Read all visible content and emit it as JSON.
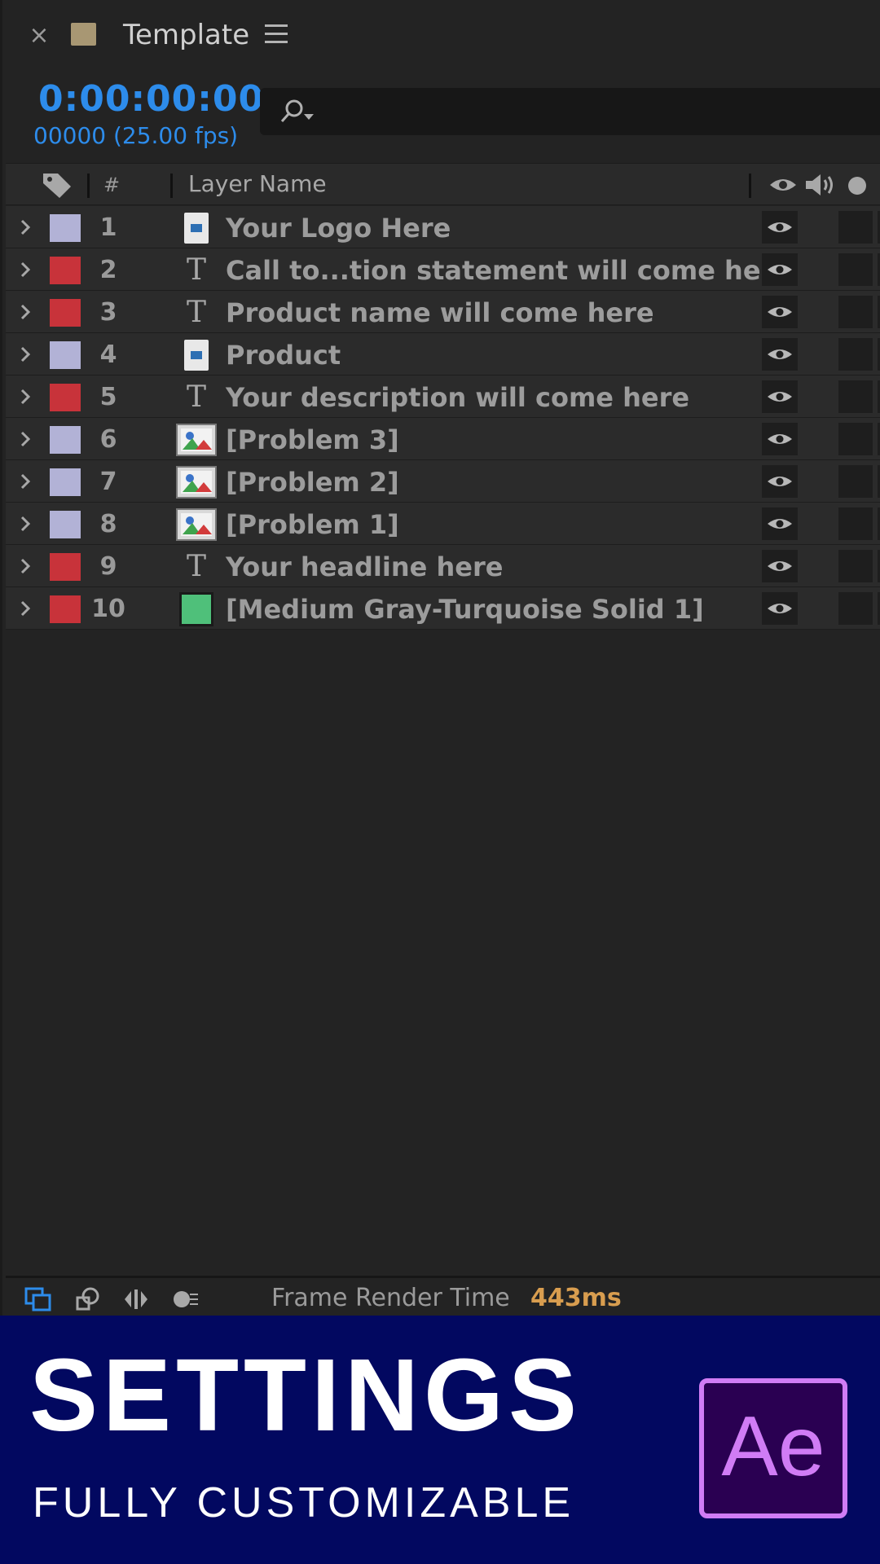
{
  "tab": {
    "close_glyph": "×",
    "title": "Template",
    "swatch_color": "#a89773"
  },
  "time": {
    "timecode": "0:00:00:00",
    "frames": "00000 (25.00 fps)"
  },
  "search": {
    "placeholder": ""
  },
  "columns": {
    "number": "#",
    "layer_name": "Layer Name"
  },
  "layers": [
    {
      "num": "1",
      "name": "Your Logo Here",
      "label_color": "#b2b2d6",
      "type": "file"
    },
    {
      "num": "2",
      "name": "Call to...tion statement will come here",
      "label_color": "#c8333a",
      "type": "text"
    },
    {
      "num": "3",
      "name": "Product name will come here",
      "label_color": "#c8333a",
      "type": "text"
    },
    {
      "num": "4",
      "name": "Product",
      "label_color": "#b2b2d6",
      "type": "file"
    },
    {
      "num": "5",
      "name": "Your description will come here",
      "label_color": "#c8333a",
      "type": "text"
    },
    {
      "num": "6",
      "name": "[Problem 3]",
      "label_color": "#b2b2d6",
      "type": "image"
    },
    {
      "num": "7",
      "name": "[Problem 2]",
      "label_color": "#b2b2d6",
      "type": "image"
    },
    {
      "num": "8",
      "name": "[Problem 1]",
      "label_color": "#b2b2d6",
      "type": "image"
    },
    {
      "num": "9",
      "name": "Your headline here",
      "label_color": "#c8333a",
      "type": "text"
    },
    {
      "num": "10",
      "name": "[Medium Gray-Turquoise Solid 1]",
      "label_color": "#c8333a",
      "type": "solid"
    }
  ],
  "text_layer_glyph": "T",
  "footer": {
    "frame_render_label": "Frame Render Time",
    "frame_render_value": "443ms"
  },
  "banner": {
    "headline": "SETTINGS",
    "subline": "FULLY CUSTOMIZABLE",
    "logo_text": "Ae"
  },
  "colors": {
    "accent_blue": "#2d8ceb",
    "render_time": "#d89d4f",
    "banner_bg": "#020860",
    "ae_purple": "#d07cf5"
  }
}
